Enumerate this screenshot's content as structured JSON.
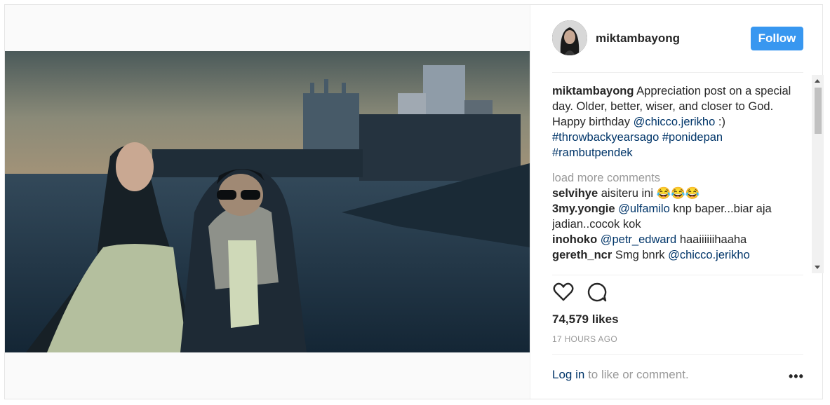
{
  "post": {
    "username": "miktambayong",
    "follow_label": "Follow",
    "caption": {
      "username": "miktambayong",
      "text": "Appreciation post on a special day. Older, better, wiser, and closer to God. Happy birthday",
      "mention": "@chicco.jerikho",
      "after": ":)",
      "hashtags": [
        "#throwbackyearsago",
        "#ponidepan",
        "#rambutpendek"
      ]
    },
    "load_more_label": "load more comments",
    "comments": [
      {
        "user": "selvihye",
        "mention": "",
        "text": "aisiteru ini 😂😂😂"
      },
      {
        "user": "3my.yongie",
        "mention": "@ulfamilo",
        "text": "knp baper...biar aja jadian..cocok kok"
      },
      {
        "user": "inohoko",
        "mention": "@petr_edward",
        "text": "haaiiiiiihaaha"
      },
      {
        "user": "gereth_ncr",
        "mention": "@chicco.jerikho",
        "text": "Smg bnrk"
      }
    ],
    "likes": "74,579 likes",
    "time": "17 HOURS AGO",
    "login_link": "Log in",
    "login_rest": "to like or comment.",
    "more_label": "•••",
    "icons": {
      "like": "heart-icon",
      "comment": "comment-icon"
    }
  },
  "colors": {
    "accent": "#3897f0",
    "link": "#003569",
    "muted": "#999999"
  }
}
